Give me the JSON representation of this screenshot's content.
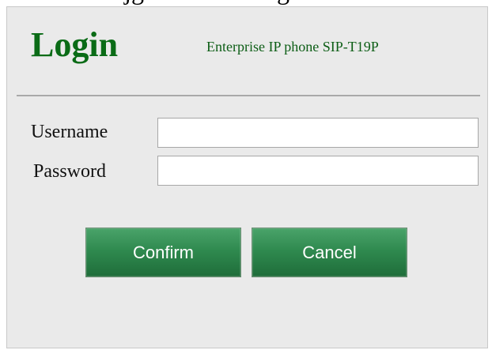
{
  "caption_partial": "U krijgt dan het inlogscherm an Yealink",
  "login": {
    "title": "Login",
    "model": "Enterprise IP phone SIP-T19P",
    "username_label": "Username",
    "password_label": "Password",
    "username_value": "",
    "password_value": "",
    "confirm_label": "Confirm",
    "cancel_label": "Cancel"
  },
  "colors": {
    "title": "#0a6b16",
    "panel_bg": "#eaeaea",
    "button_bg": "#2f8a4f",
    "button_text": "#ffffff"
  }
}
